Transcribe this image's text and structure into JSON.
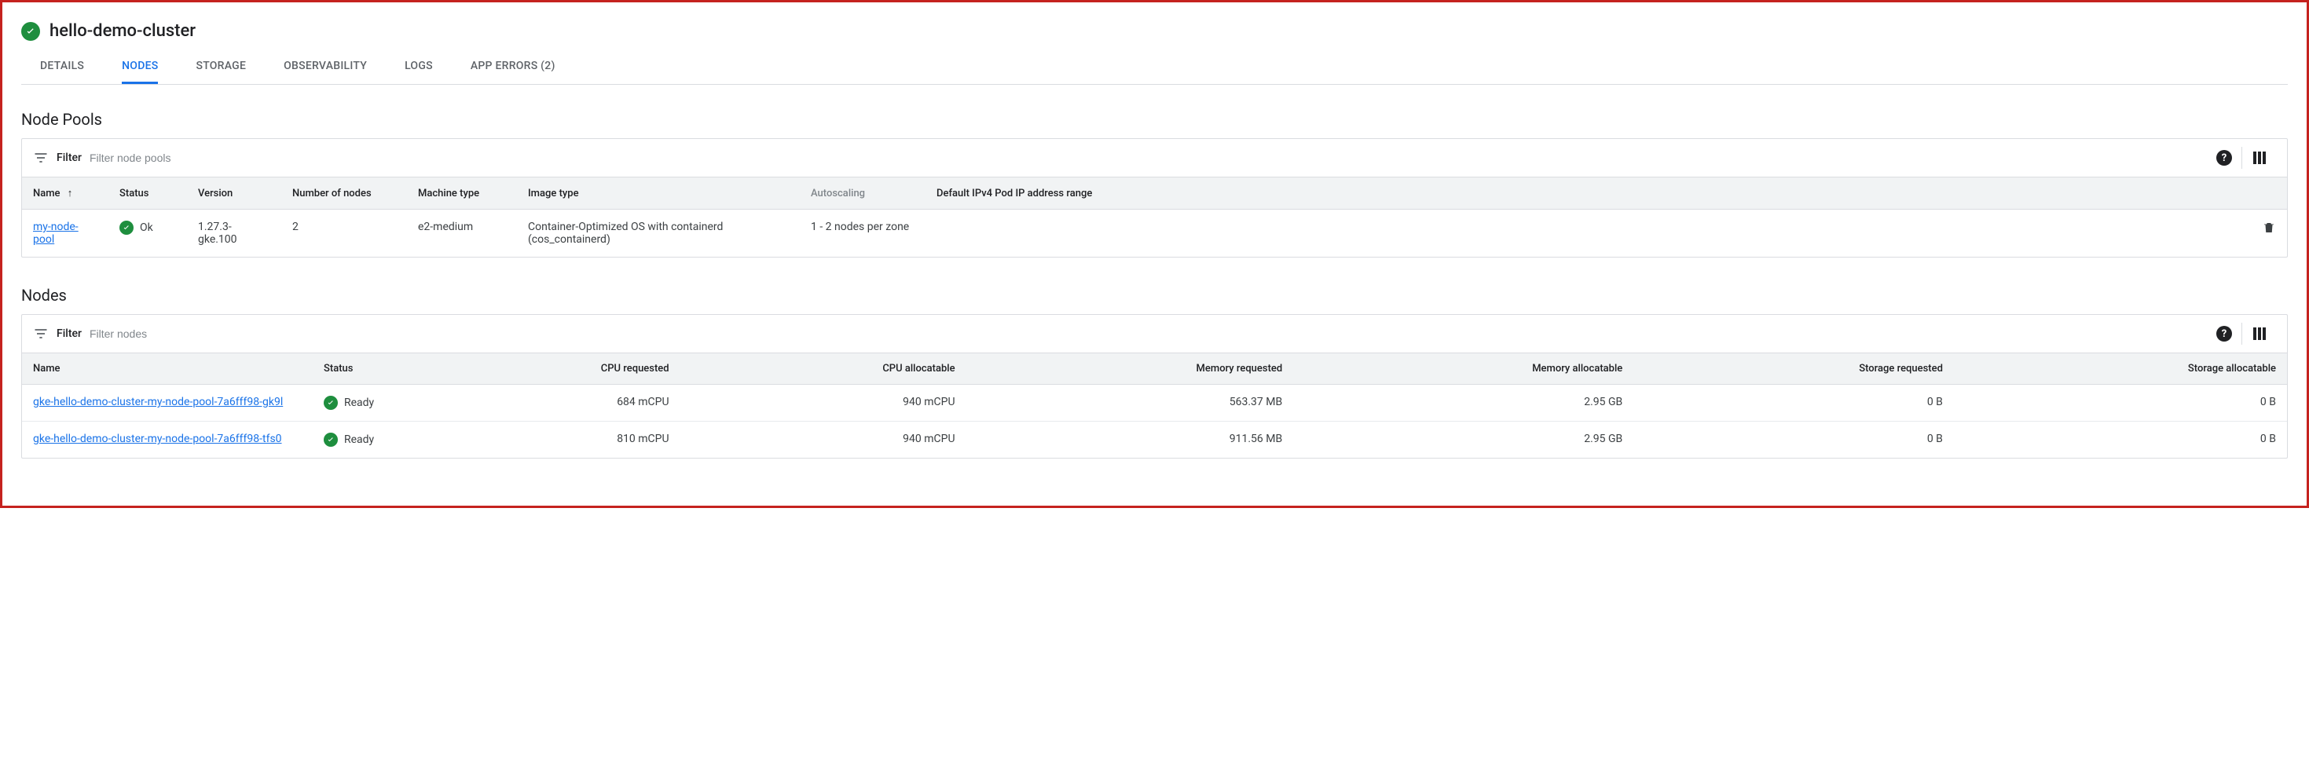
{
  "header": {
    "title": "hello-demo-cluster"
  },
  "tabs": {
    "details": "DETAILS",
    "nodes": "NODES",
    "storage": "STORAGE",
    "observability": "OBSERVABILITY",
    "logs": "LOGS",
    "app_errors": "APP ERRORS (2)"
  },
  "sections": {
    "node_pools": "Node Pools",
    "nodes": "Nodes"
  },
  "filter": {
    "label": "Filter",
    "pools_placeholder": "Filter node pools",
    "nodes_placeholder": "Filter nodes",
    "help": "?"
  },
  "pool_headers": {
    "name": "Name",
    "status": "Status",
    "version": "Version",
    "num_nodes": "Number of nodes",
    "machine": "Machine type",
    "image": "Image type",
    "autoscaling": "Autoscaling",
    "range": "Default IPv4 Pod IP address range"
  },
  "pools": [
    {
      "name": "my-node-pool",
      "status": "Ok",
      "version": "1.27.3-gke.100",
      "num_nodes": "2",
      "machine": "e2-medium",
      "image": "Container-Optimized OS with containerd (cos_containerd)",
      "autoscaling": "1 - 2 nodes per zone",
      "range": ""
    }
  ],
  "node_headers": {
    "name": "Name",
    "status": "Status",
    "cpu_req": "CPU requested",
    "cpu_alloc": "CPU allocatable",
    "mem_req": "Memory requested",
    "mem_alloc": "Memory allocatable",
    "stor_req": "Storage requested",
    "stor_alloc": "Storage allocatable"
  },
  "nodes": [
    {
      "name": "gke-hello-demo-cluster-my-node-pool-7a6fff98-gk9l",
      "status": "Ready",
      "cpu_req": "684 mCPU",
      "cpu_alloc": "940 mCPU",
      "mem_req": "563.37 MB",
      "mem_alloc": "2.95 GB",
      "stor_req": "0 B",
      "stor_alloc": "0 B"
    },
    {
      "name": "gke-hello-demo-cluster-my-node-pool-7a6fff98-tfs0",
      "status": "Ready",
      "cpu_req": "810 mCPU",
      "cpu_alloc": "940 mCPU",
      "mem_req": "911.56 MB",
      "mem_alloc": "2.95 GB",
      "stor_req": "0 B",
      "stor_alloc": "0 B"
    }
  ]
}
